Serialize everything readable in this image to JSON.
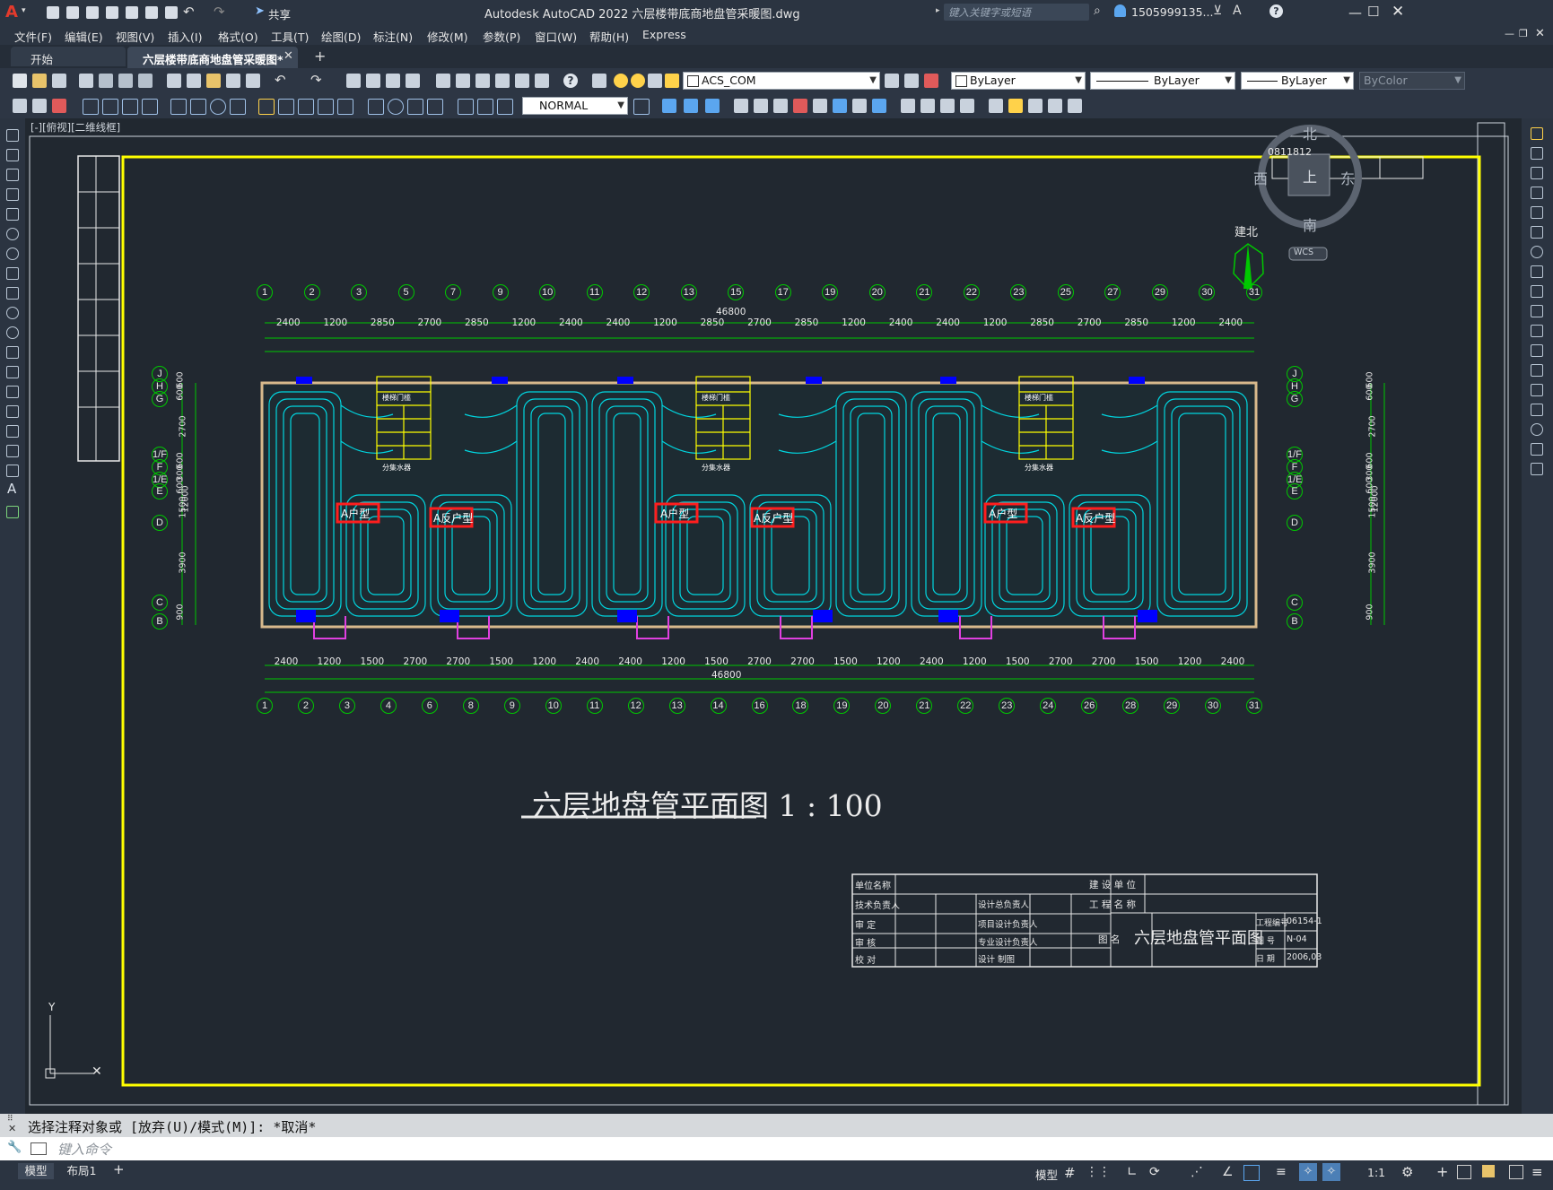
{
  "app": {
    "title": "Autodesk AutoCAD 2022    六层楼带底商地盘管采暖图.dwg",
    "share_label": "共享",
    "search_placeholder": "键入关键字或短语",
    "user": "1505999135...",
    "viewport_label": "[-][俯视][二维线框]"
  },
  "menu": [
    "文件(F)",
    "编辑(E)",
    "视图(V)",
    "插入(I)",
    "格式(O)",
    "工具(T)",
    "绘图(D)",
    "标注(N)",
    "修改(M)",
    "参数(P)",
    "窗口(W)",
    "帮助(H)",
    "Express"
  ],
  "tabs": [
    {
      "label": "开始",
      "active": false
    },
    {
      "label": "六层楼带底商地盘管采暖图*",
      "active": true
    }
  ],
  "properties": {
    "layer": "ACS_COM",
    "color": "ByLayer",
    "linetype": "ByLayer",
    "lineweight": "ByLayer",
    "plotstyle": "ByColor",
    "dimstyle": "NORMAL"
  },
  "viewcube": {
    "north": "北",
    "south": "南",
    "east": "东",
    "west": "西",
    "top": "上",
    "wcs": "WCS",
    "compass_label": "建北"
  },
  "drawing": {
    "title": "六层地盘管平面图 1 : 100",
    "top_grid": [
      "1",
      "2",
      "3",
      "5",
      "7",
      "9",
      "10",
      "11",
      "12",
      "13",
      "15",
      "17",
      "19",
      "20",
      "21",
      "22",
      "23",
      "25",
      "27",
      "29",
      "30",
      "31"
    ],
    "bottom_grid": [
      "1",
      "2",
      "3",
      "4",
      "6",
      "8",
      "9",
      "10",
      "11",
      "12",
      "13",
      "14",
      "16",
      "18",
      "19",
      "20",
      "21",
      "22",
      "23",
      "24",
      "26",
      "28",
      "29",
      "30",
      "31"
    ],
    "top_dims": [
      "2400",
      "1200",
      "2850",
      "2700",
      "2850",
      "1200",
      "2400",
      "2400",
      "1200",
      "2850",
      "2700",
      "2850",
      "1200",
      "2400",
      "2400",
      "1200",
      "2850",
      "2700",
      "2850",
      "1200",
      "2400"
    ],
    "bottom_dims": [
      "2400",
      "1200",
      "1500",
      "2700",
      "2700",
      "1500",
      "1200",
      "2400",
      "2400",
      "1200",
      "1500",
      "2700",
      "2700",
      "1500",
      "1200",
      "2400",
      "1200",
      "1500",
      "2700",
      "2700",
      "1500",
      "1200",
      "2400"
    ],
    "overall_dim": "46800",
    "row_labels": [
      "J",
      "H",
      "G",
      "1/F",
      "F",
      "1/E",
      "E",
      "D",
      "C",
      "B"
    ],
    "left_dims": [
      "600",
      "600",
      "2700",
      "600",
      "300",
      "600",
      "1500",
      "3900",
      "900",
      "12000"
    ],
    "unit_labels": [
      "A户型",
      "A反户型",
      "A户型",
      "A反户型",
      "A户型",
      "A反户型"
    ],
    "stair_labels": [
      "楼梯门槛",
      "分集水器"
    ],
    "drawing_no_box": "0811812"
  },
  "titleblock": {
    "rows_left": [
      "单位名称",
      "技术负责人",
      "审    定",
      "审    核",
      "校    对"
    ],
    "rows_mid": [
      "设计总负责人",
      "项目设计负责人",
      "专业设计负责人",
      "设计    制图"
    ],
    "right_labels": [
      "建 设 单 位",
      "工 程 名 称"
    ],
    "sheet_title": "六层地盘管平面图",
    "note_label": "图 名",
    "meta": [
      {
        "k": "工程编号",
        "v": "06154-1"
      },
      {
        "k": "图  号",
        "v": "N-04"
      },
      {
        "k": "日  期",
        "v": "2006,03"
      }
    ]
  },
  "command": {
    "history": "选择注释对象或 [放弃(U)/模式(M)]: *取消*",
    "placeholder": "键入命令"
  },
  "status": {
    "layout_tabs": [
      "模型",
      "布局1"
    ],
    "model_label": "模型",
    "scale": "1:1"
  },
  "colors": {
    "pipe": "#00d6e0",
    "grid": "#00c800",
    "wall": "#d7b98c",
    "frame": "#ffff00",
    "label_box": "#ff1e1e"
  }
}
